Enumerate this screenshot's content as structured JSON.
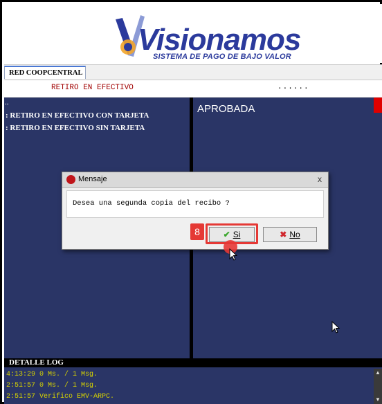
{
  "logo": {
    "title": "Visionamos",
    "subtitle": "SISTEMA DE PAGO DE BAJO VALOR"
  },
  "tab": {
    "label": "RED COOPCENTRAL"
  },
  "operation": {
    "name": "RETIRO EN EFECTIVO",
    "dots": "......"
  },
  "menu": {
    "dash": "..",
    "items": [
      {
        "label": ": RETIRO EN EFECTIVO CON TARJETA"
      },
      {
        "label": ": RETIRO EN EFECTIVO SIN TARJETA"
      }
    ]
  },
  "status": {
    "text": "APROBADA"
  },
  "dialog": {
    "title": "Mensaje",
    "close": "x",
    "message": "Desea una segunda copia del recibo ?",
    "yes_label": "Si",
    "no_label": "No"
  },
  "annotation": {
    "step": "8"
  },
  "log": {
    "title": "DETALLE LOG",
    "lines": [
      "4:13:29 0 Ms. / 1 Msg.",
      "2:51:57 0 Ms. / 1 Msg.",
      "2:51:57 Verifico EMV-ARPC."
    ]
  },
  "colors": {
    "panel_bg": "#2a3566",
    "accent_red": "#e53935",
    "log_text": "#d7d300"
  },
  "icons": {
    "dialog": "stop-hand-icon",
    "yes": "check-icon",
    "no": "x-icon",
    "cursor": "mouse-pointer-icon"
  }
}
